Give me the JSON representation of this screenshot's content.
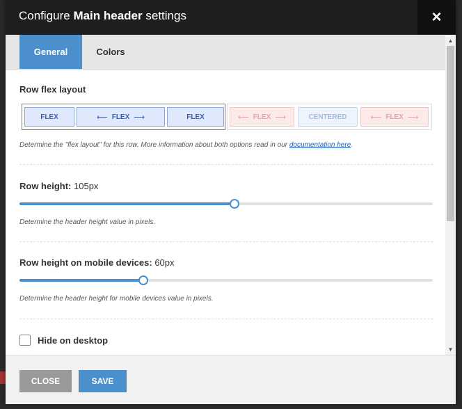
{
  "dialog": {
    "title_prefix": "Configure ",
    "title_bold": "Main header",
    "title_suffix": " settings",
    "close_icon": "×"
  },
  "tabs": [
    {
      "label": "General",
      "active": true
    },
    {
      "label": "Colors",
      "active": false
    }
  ],
  "row_flex_layout": {
    "label": "Row flex layout",
    "options": [
      {
        "name": "flex-flex-flex",
        "selected": true,
        "cells": [
          "FLEX",
          "FLEX",
          "FLEX"
        ]
      },
      {
        "name": "flex-centered-flex",
        "selected": false,
        "cells": [
          "FLEX",
          "CENTERED",
          "FLEX"
        ]
      }
    ],
    "hint_text": "Determine the \"flex layout\" for this row. More information about both options read in our ",
    "hint_link": "documentation here",
    "hint_end": "."
  },
  "row_height": {
    "label": "Row height:",
    "value": "105px",
    "fraction": 0.52,
    "hint": "Determine the header height value in pixels."
  },
  "row_height_mobile": {
    "label": "Row height on mobile devices:",
    "value": "60px",
    "fraction": 0.3,
    "hint": "Determine the header height for mobile devices value in pixels."
  },
  "hide_desktop": {
    "label": "Hide on desktop",
    "checked": false
  },
  "footer": {
    "close_label": "CLOSE",
    "save_label": "SAVE"
  },
  "colors": {
    "accent": "#4b8fcc",
    "header_bg": "#1e1e1e",
    "close_btn": "#9a9a9a"
  }
}
